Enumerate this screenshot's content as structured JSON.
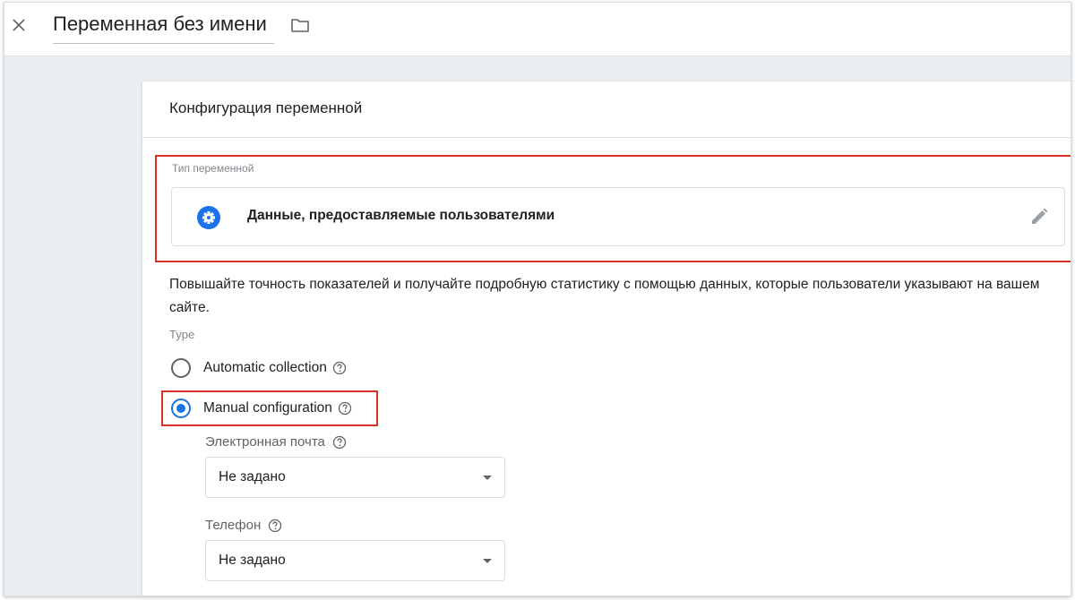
{
  "header": {
    "title": "Переменная без имени"
  },
  "card": {
    "title": "Конфигурация переменной",
    "variable_type": {
      "label": "Тип переменной",
      "name": "Данные, предоставляемые пользователями"
    },
    "description": "Повышайте точность показателей и получайте подробную статистику с помощью данных, которые пользователи указывают на вашем сайте.",
    "type_caption": "Type",
    "options": [
      {
        "label": "Automatic collection",
        "checked": false
      },
      {
        "label": "Manual configuration",
        "checked": true
      }
    ],
    "fields": {
      "email": {
        "label": "Электронная почта",
        "value": "Не задано"
      },
      "phone": {
        "label": "Телефон",
        "value": "Не задано"
      }
    }
  },
  "colors": {
    "accent": "#1a73e8",
    "highlight": "#d93025"
  }
}
